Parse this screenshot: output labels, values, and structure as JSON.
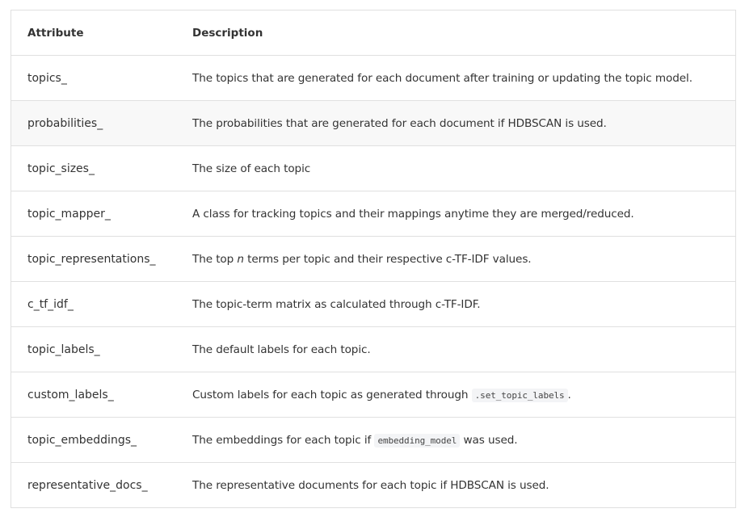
{
  "table": {
    "headers": {
      "attribute": "Attribute",
      "description": "Description"
    },
    "rows": [
      {
        "attribute": "topics_",
        "description": "The topics that are generated for each document after training or updating the topic model."
      },
      {
        "attribute": "probabilities_",
        "description": "The probabilities that are generated for each document if HDBSCAN is used."
      },
      {
        "attribute": "topic_sizes_",
        "description": "The size of each topic"
      },
      {
        "attribute": "topic_mapper_",
        "description": "A class for tracking topics and their mappings anytime they are merged/reduced."
      },
      {
        "attribute": "topic_representations_",
        "desc_before": "The top ",
        "desc_em": "n",
        "desc_after": " terms per topic and their respective c-TF-IDF values."
      },
      {
        "attribute": "c_tf_idf_",
        "description": "The topic-term matrix as calculated through c-TF-IDF."
      },
      {
        "attribute": "topic_labels_",
        "description": "The default labels for each topic."
      },
      {
        "attribute": "custom_labels_",
        "desc_before": "Custom labels for each topic as generated through ",
        "desc_code": ".set_topic_labels",
        "desc_after": "."
      },
      {
        "attribute": "topic_embeddings_",
        "desc_before": "The embeddings for each topic if ",
        "desc_code": "embedding_model",
        "desc_after": " was used."
      },
      {
        "attribute": "representative_docs_",
        "description": "The representative documents for each topic if HDBSCAN is used."
      }
    ]
  }
}
